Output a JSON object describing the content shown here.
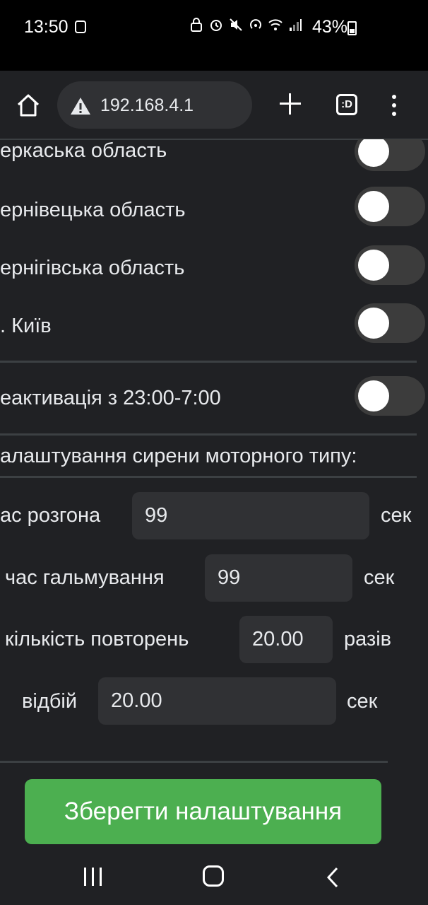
{
  "status_bar": {
    "time": "13:50",
    "battery": "43%"
  },
  "browser": {
    "url": "192.168.4.1",
    "tabs_label": ":D"
  },
  "regions": [
    {
      "label": "еркаська область",
      "enabled": false
    },
    {
      "label": "ернівецька область",
      "enabled": false
    },
    {
      "label": "ернігівська область",
      "enabled": false
    },
    {
      "label": ". Київ",
      "enabled": false
    }
  ],
  "deactivation": {
    "label": "еактивація з 23:00-7:00",
    "enabled": false
  },
  "siren_section_title": "алаштування сирени моторного типу:",
  "siren_fields": [
    {
      "label": "ас розгона",
      "value": "99",
      "unit": "сек"
    },
    {
      "label": "час гальмування",
      "value": "99",
      "unit": "сек"
    },
    {
      "label": "кількість повторень",
      "value": "20.00",
      "unit": "разів"
    },
    {
      "label": "відбій",
      "value": "20.00",
      "unit": "сек"
    }
  ],
  "save_button": "Зберегти налаштування",
  "colors": {
    "background": "#202124",
    "save_button": "#4caf50",
    "toggle_off": "#3c3c3c"
  }
}
